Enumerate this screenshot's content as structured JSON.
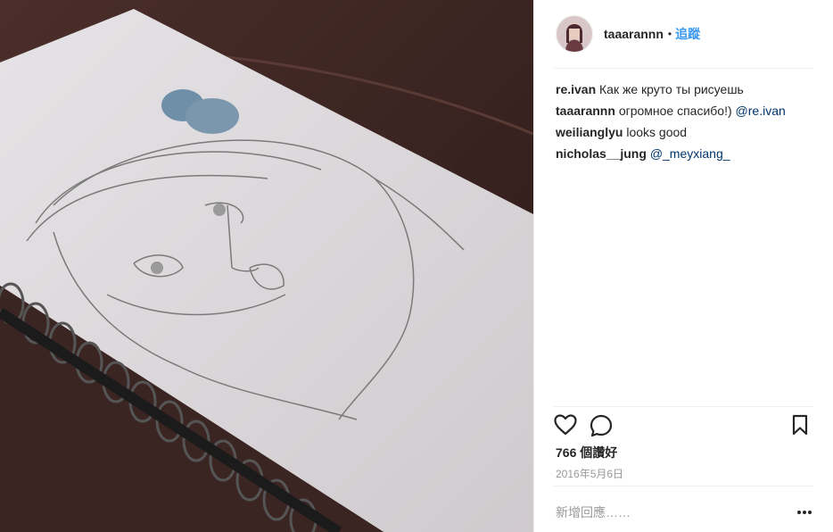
{
  "post": {
    "username": "taaarannn",
    "separator": "•",
    "follow_label": "追蹤"
  },
  "comments": [
    {
      "user": "re.ivan",
      "text": "Как же круто ты рисуешь",
      "mention": ""
    },
    {
      "user": "taaarannn",
      "text": "огромное спасибо!) ",
      "mention": "@re.ivan"
    },
    {
      "user": "weilianglyu",
      "text": "looks good",
      "mention": ""
    },
    {
      "user": "nicholas__jung",
      "text": "",
      "mention": "@_meyxiang_"
    }
  ],
  "stats": {
    "likes": "766 個讚好",
    "date": "2016年5月6日"
  },
  "add_comment": {
    "placeholder": "新增回應……"
  },
  "icons": {
    "like": "heart-icon",
    "comment": "comment-icon",
    "save": "bookmark-icon",
    "more": "more-options-icon"
  },
  "colors": {
    "follow": "#3897f0",
    "mention": "#003569",
    "muted": "#999999",
    "border": "#efefef"
  }
}
